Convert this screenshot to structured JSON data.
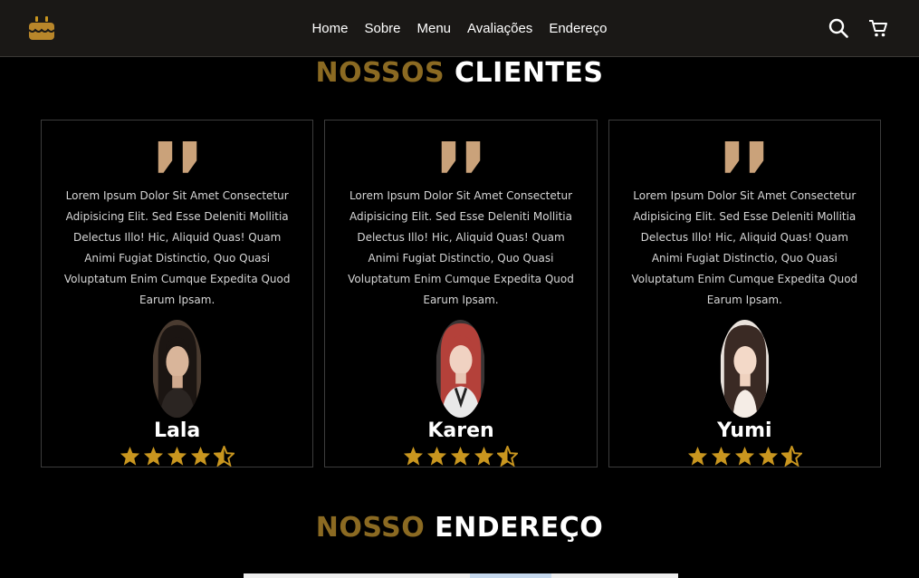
{
  "nav": {
    "logo_icon": "cake-icon",
    "links": [
      "Home",
      "Sobre",
      "Menu",
      "Avaliações",
      "Endereço"
    ],
    "search_icon": "search-icon",
    "cart_icon": "cart-icon"
  },
  "clients_section": {
    "title_accent": "NOSSOS",
    "title_rest": "CLIENTES"
  },
  "testimonials": [
    {
      "text": "Lorem Ipsum Dolor Sit Amet Consectetur Adipisicing Elit. Sed Esse Deleniti Mollitia Delectus Illo! Hic, Aliquid Quas! Quam Animi Fugiat Distinctio, Quo Quasi Voluptatum Enim Cumque Expedita Quod Earum Ipsam.",
      "name": "Lala",
      "rating": 4.5
    },
    {
      "text": "Lorem Ipsum Dolor Sit Amet Consectetur Adipisicing Elit. Sed Esse Deleniti Mollitia Delectus Illo! Hic, Aliquid Quas! Quam Animi Fugiat Distinctio, Quo Quasi Voluptatum Enim Cumque Expedita Quod Earum Ipsam.",
      "name": "Karen",
      "rating": 4.5
    },
    {
      "text": "Lorem Ipsum Dolor Sit Amet Consectetur Adipisicing Elit. Sed Esse Deleniti Mollitia Delectus Illo! Hic, Aliquid Quas! Quam Animi Fugiat Distinctio, Quo Quasi Voluptatum Enim Cumque Expedita Quod Earum Ipsam.",
      "name": "Yumi",
      "rating": 4.5
    }
  ],
  "address_section": {
    "title_accent": "NOSSO",
    "title_rest": "ENDEREÇO"
  },
  "colors": {
    "accent": "#8b6a22",
    "star": "#c9961f",
    "quote": "#caa27a",
    "nav_bg": "#1a1816"
  }
}
